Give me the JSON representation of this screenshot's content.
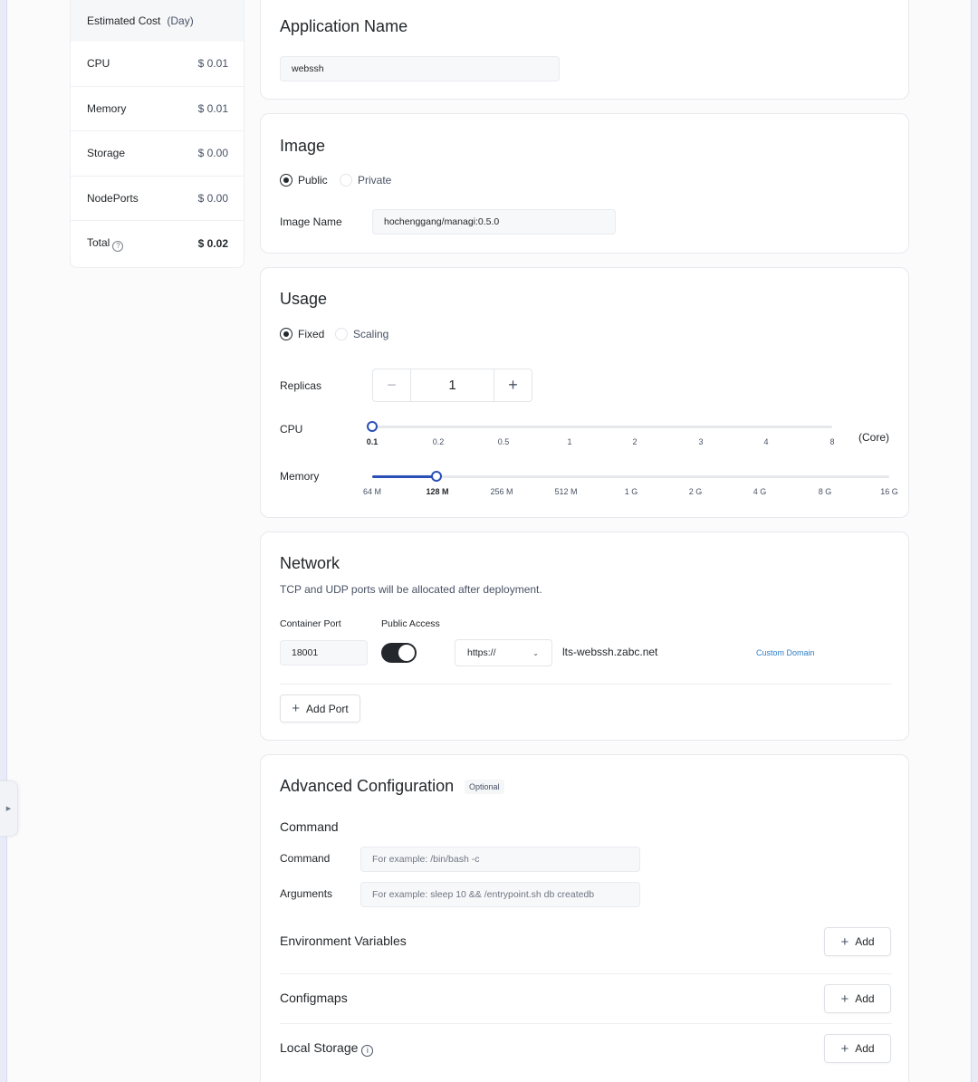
{
  "cost": {
    "header": "Estimated Cost",
    "unit": "(Day)",
    "rows": [
      {
        "label": "CPU",
        "value": "$ 0.01"
      },
      {
        "label": "Memory",
        "value": "$ 0.01"
      },
      {
        "label": "Storage",
        "value": "$ 0.00"
      },
      {
        "label": "NodePorts",
        "value": "$ 0.00"
      }
    ],
    "total_label": "Total",
    "total_value": "$ 0.02"
  },
  "app": {
    "title": "Application Name",
    "name_value": "webssh"
  },
  "image": {
    "title": "Image",
    "public_label": "Public",
    "private_label": "Private",
    "selected": "Public",
    "name_label": "Image Name",
    "name_value": "hochenggang/managi:0.5.0"
  },
  "usage": {
    "title": "Usage",
    "fixed_label": "Fixed",
    "scaling_label": "Scaling",
    "selected": "Fixed",
    "replicas_label": "Replicas",
    "replicas_value": "1",
    "cpu_label": "CPU",
    "cpu_ticks": [
      "0.1",
      "0.2",
      "0.5",
      "1",
      "2",
      "3",
      "4",
      "8"
    ],
    "cpu_selected": "0.1",
    "cpu_unit": "(Core)",
    "memory_label": "Memory",
    "memory_ticks": [
      "64 M",
      "128 M",
      "256 M",
      "512 M",
      "1 G",
      "2 G",
      "4 G",
      "8 G",
      "16 G"
    ],
    "memory_selected": "128 M"
  },
  "network": {
    "title": "Network",
    "desc": "TCP and UDP ports will be allocated after deployment.",
    "port_label": "Container Port",
    "access_label": "Public Access",
    "port_value": "18001",
    "public_access": true,
    "protocol": "https://",
    "domain": "lts-webssh.zabc.net",
    "custom_domain": "Custom Domain",
    "add_port": "Add Port"
  },
  "advanced": {
    "title": "Advanced Configuration",
    "optional": "Optional",
    "command_section": "Command",
    "command_label": "Command",
    "command_placeholder": "For example:  /bin/bash -c",
    "args_label": "Arguments",
    "args_placeholder": "For example:  sleep 10 && /entrypoint.sh db createdb",
    "env_label": "Environment Variables",
    "configmaps_label": "Configmaps",
    "storage_label": "Local Storage",
    "add_label": "Add"
  }
}
